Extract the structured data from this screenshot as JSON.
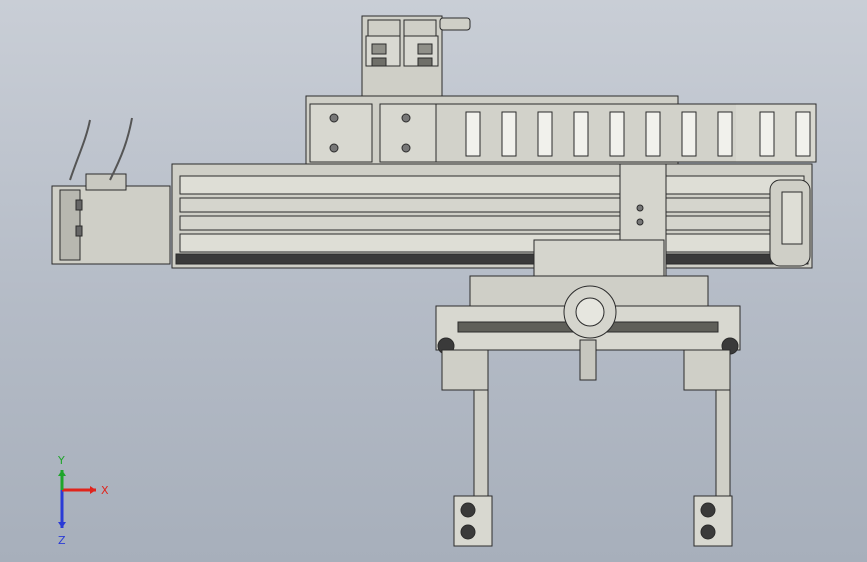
{
  "viewport": {
    "background_top": "#c9ced6",
    "background_bottom": "#a7afbb"
  },
  "model": {
    "part_fill": "#cfcfc7",
    "part_stroke": "#2b2b2b",
    "rail_fill": "#c4c4bb",
    "dark_fill": "#3a3a3a"
  },
  "triad": {
    "x_label": "X",
    "y_label": "Y",
    "z_label": "Z",
    "x_color": "#e0241c",
    "y_color": "#1fa52b",
    "z_color": "#2a3bd6"
  }
}
